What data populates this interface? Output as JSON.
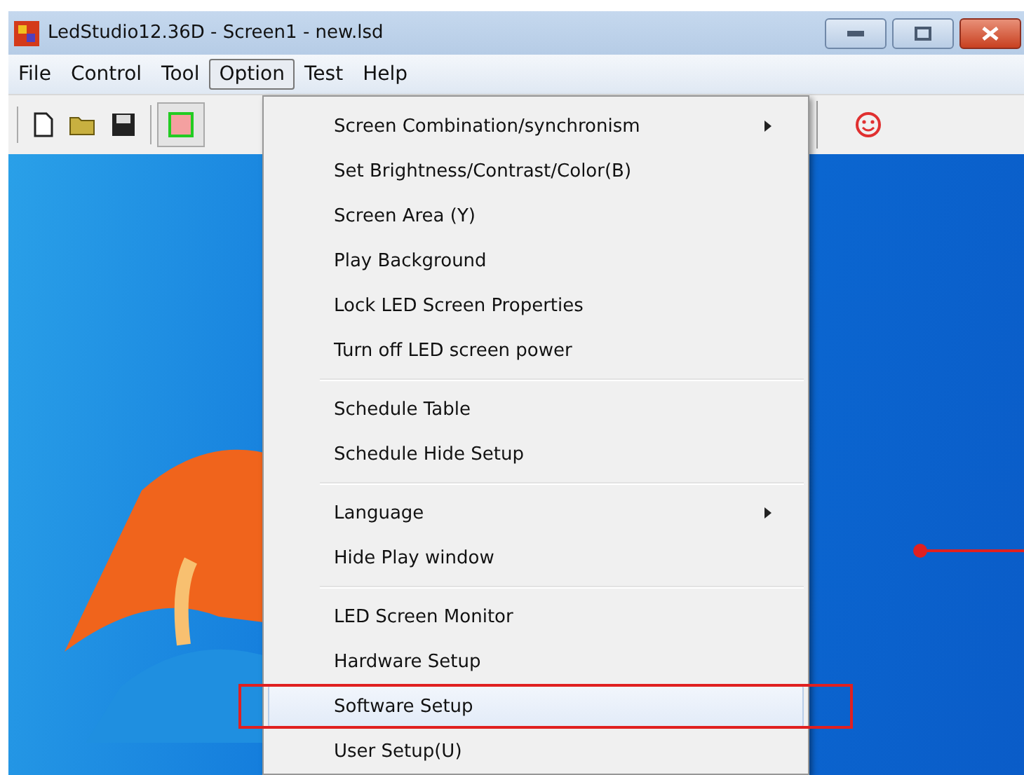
{
  "window": {
    "title": "LedStudio12.36D - Screen1 - new.lsd"
  },
  "menubar": [
    {
      "label": "File",
      "selected": false
    },
    {
      "label": "Control",
      "selected": false
    },
    {
      "label": "Tool",
      "selected": false
    },
    {
      "label": "Option",
      "selected": true
    },
    {
      "label": "Test",
      "selected": false
    },
    {
      "label": "Help",
      "selected": false
    }
  ],
  "option_menu": {
    "groups": [
      {
        "items": [
          {
            "label": "Screen Combination/synchronism",
            "submenu": true,
            "selected": false
          },
          {
            "label": "Set Brightness/Contrast/Color(B)",
            "submenu": false,
            "selected": false
          },
          {
            "label": "Screen Area (Y)",
            "submenu": false,
            "selected": false
          },
          {
            "label": "Play Background",
            "submenu": false,
            "selected": false
          },
          {
            "label": "Lock LED Screen Properties",
            "submenu": false,
            "selected": false
          },
          {
            "label": "Turn off LED screen power",
            "submenu": false,
            "selected": false
          }
        ]
      },
      {
        "items": [
          {
            "label": "Schedule Table",
            "submenu": false,
            "selected": false
          },
          {
            "label": "Schedule Hide Setup",
            "submenu": false,
            "selected": false
          }
        ]
      },
      {
        "items": [
          {
            "label": "Language",
            "submenu": true,
            "selected": false
          },
          {
            "label": "Hide Play window",
            "submenu": false,
            "selected": false
          }
        ]
      },
      {
        "items": [
          {
            "label": "LED Screen Monitor",
            "submenu": false,
            "selected": false
          },
          {
            "label": "Hardware Setup",
            "submenu": false,
            "selected": false
          },
          {
            "label": "Software Setup",
            "submenu": false,
            "selected": true
          },
          {
            "label": "User Setup(U)",
            "submenu": false,
            "selected": false
          }
        ]
      }
    ]
  }
}
